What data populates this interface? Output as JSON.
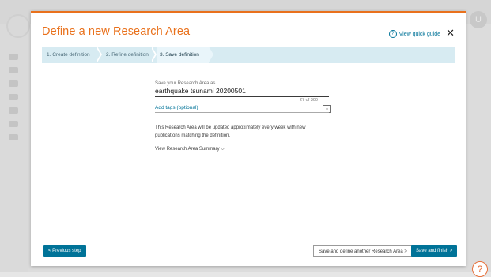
{
  "modal": {
    "title": "Define a new Research Area",
    "quick_guide": "View quick guide",
    "quick_guide_icon": "?",
    "close_glyph": "✕"
  },
  "steps": [
    {
      "label": "1. Create definition",
      "active": false
    },
    {
      "label": "2. Refine definition",
      "active": false
    },
    {
      "label": "3. Save definition",
      "active": true
    }
  ],
  "save": {
    "label": "Save your Research Area as",
    "value": "earthquake tsunami 20200501",
    "char_count": "27 of 300"
  },
  "tags": {
    "label": "Add tags (optional)",
    "toggle_glyph": "⌄"
  },
  "info_text": "This Research Area will be updated approximately every week with new publications matching the definition.",
  "summary_link": "View Research Area Summary ⌵",
  "footer": {
    "previous": "< Previous step",
    "save_another": "Save and define another Research Area  >",
    "save_finish": "Save and finish  >"
  },
  "background": {
    "help_glyph": "?",
    "avatar_glyph": "U"
  },
  "colors": {
    "accent": "#e9711c",
    "link": "#007398",
    "steps_bg": "#d7ebf2"
  }
}
